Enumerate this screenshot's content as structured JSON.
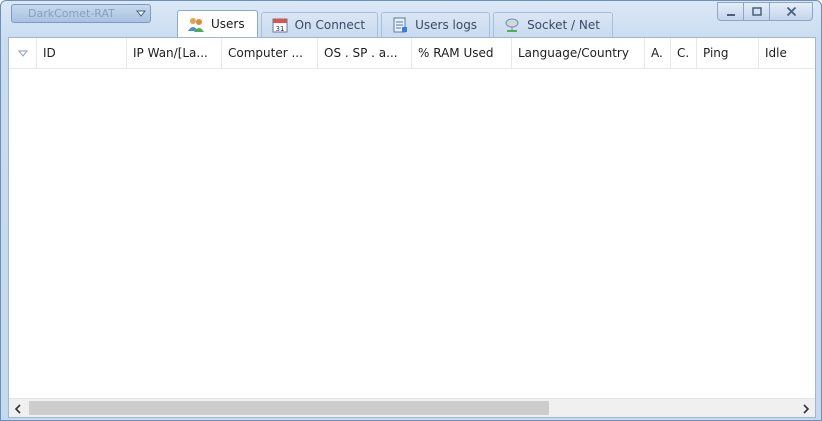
{
  "app_button": {
    "label": "DarkComet-RAT"
  },
  "tabs": [
    {
      "label": "Users",
      "icon": "users-icon",
      "active": true
    },
    {
      "label": "On Connect",
      "icon": "calendar-icon",
      "active": false
    },
    {
      "label": "Users logs",
      "icon": "log-icon",
      "active": false
    },
    {
      "label": "Socket / Net",
      "icon": "network-icon",
      "active": false
    }
  ],
  "calendar_day": "31",
  "window_controls": [
    "minimize",
    "maximize",
    "close"
  ],
  "columns": [
    {
      "label": "ID"
    },
    {
      "label": "IP Wan/[La..."
    },
    {
      "label": "Computer ..."
    },
    {
      "label": "OS . SP . a..."
    },
    {
      "label": "% RAM Used"
    },
    {
      "label": "Language/Country"
    },
    {
      "label": "A."
    },
    {
      "label": "C."
    },
    {
      "label": "Ping"
    },
    {
      "label": "Idle"
    }
  ],
  "rows": [],
  "colors": {
    "accent": "#c4d8ee",
    "border": "#6f8fb6"
  }
}
